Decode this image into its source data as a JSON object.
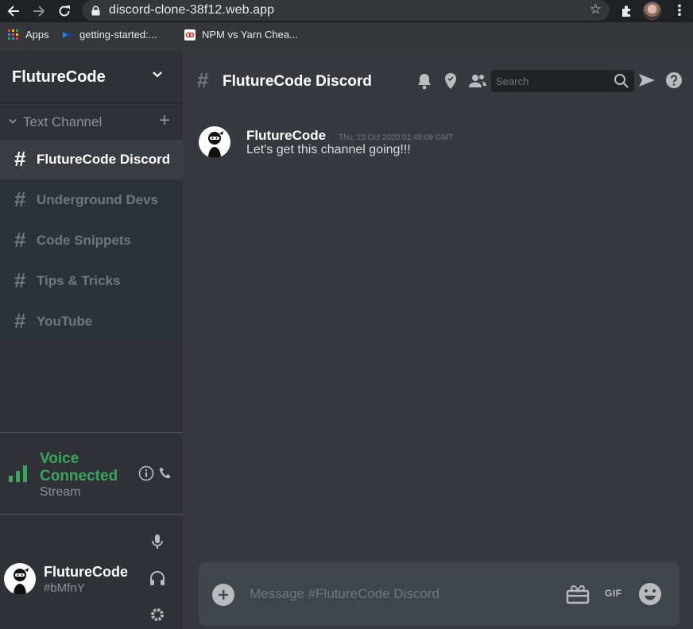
{
  "browser": {
    "url": "discord-clone-38f12.web.app",
    "bookmarks": [
      {
        "label": "Apps"
      },
      {
        "label": "getting-started:..."
      },
      {
        "label": "NPM vs Yarn Chea..."
      }
    ]
  },
  "sidebar": {
    "server_name": "FlutureCode",
    "channels_header": "Text Channel",
    "channels": [
      {
        "hash": "#",
        "name": "FlutureCode Discord",
        "active": true
      },
      {
        "hash": "#",
        "name": "Underground Devs"
      },
      {
        "hash": "#",
        "name": "Code Snippets"
      },
      {
        "hash": "#",
        "name": "Tips & Tricks"
      },
      {
        "hash": "#",
        "name": "YouTube"
      }
    ],
    "voice": {
      "title": "Voice Connected",
      "subtitle": "Stream"
    },
    "user": {
      "name": "FlutureCode",
      "tag": "#bMfnY"
    }
  },
  "main": {
    "header": {
      "hash": "#",
      "title": "FlutureCode Discord",
      "search_placeholder": "Search"
    },
    "messages": [
      {
        "author": "FlutureCode",
        "timestamp": "Thu, 15 Oct 2020 01:49:09 GMT",
        "text": "Let's get this channel going!!!"
      }
    ],
    "composer": {
      "placeholder": "Message #FlutureCode Discord",
      "gif_label": "GIF"
    }
  },
  "colors": {
    "accent_green": "#3ba55d",
    "sidebar_bg": "#2f3136",
    "main_bg": "#36393f",
    "header_text": "#ffffff",
    "muted_text": "#72767d"
  }
}
